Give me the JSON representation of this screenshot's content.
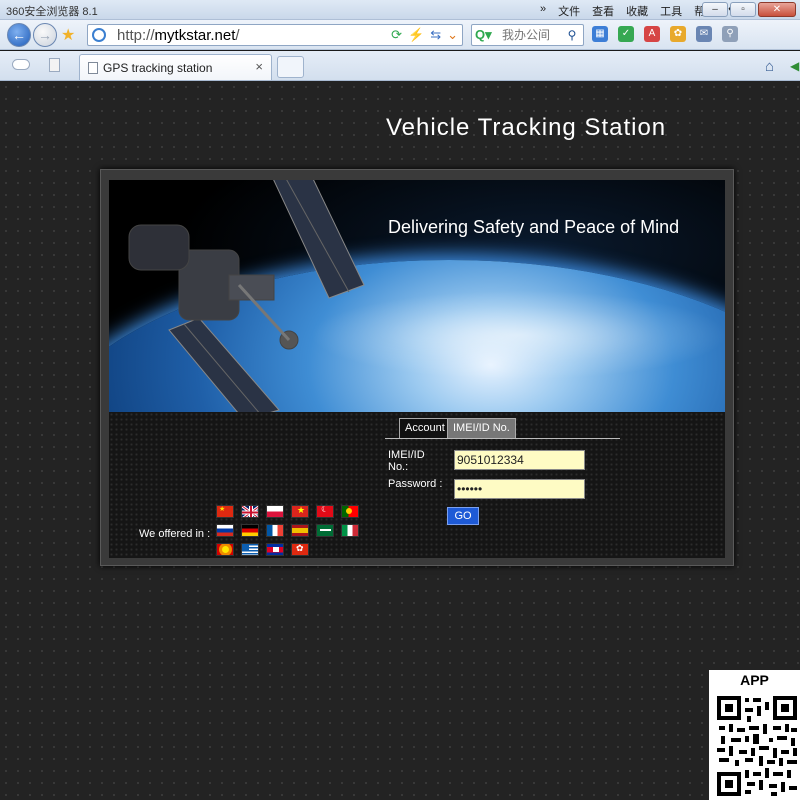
{
  "browser": {
    "app_title": "360安全浏览器 8.1",
    "menu": [
      "文件",
      "查看",
      "收藏",
      "工具",
      "帮助"
    ],
    "url_scheme": "http://",
    "url_host": "mytkstar.net",
    "url_suffix": "/",
    "search_placeholder": "我办公间",
    "tab_title": "GPS tracking station",
    "tab_close": "×"
  },
  "page": {
    "site_title": "Vehicle Tracking Station",
    "tagline": "Delivering Safety and Peace of Mind",
    "login": {
      "tab_account": "Account",
      "tab_imei": "IMEI/ID No.",
      "imei_label": "IMEI/ID No.:",
      "imei_value": "9051012334",
      "password_label": "Password :",
      "password_value": "••••••",
      "go_label": "GO"
    },
    "languages_label": "We offered in :",
    "language_flags": [
      "china-flag",
      "uk-flag",
      "poland-flag",
      "vietnam-flag",
      "turkey-flag",
      "portugal-flag",
      "russia-flag",
      "germany-flag",
      "france-flag",
      "spain-flag",
      "saudi-arabia-flag",
      "italy-flag",
      "macedonia-flag",
      "greece-flag",
      "cambodia-flag",
      "hong-kong-flag"
    ],
    "app_label": "APP"
  },
  "colors": {
    "page_background": "#232323",
    "input_background": "#fefbc4",
    "go_button": "#1e5ad6",
    "active_tab": "#777777"
  }
}
